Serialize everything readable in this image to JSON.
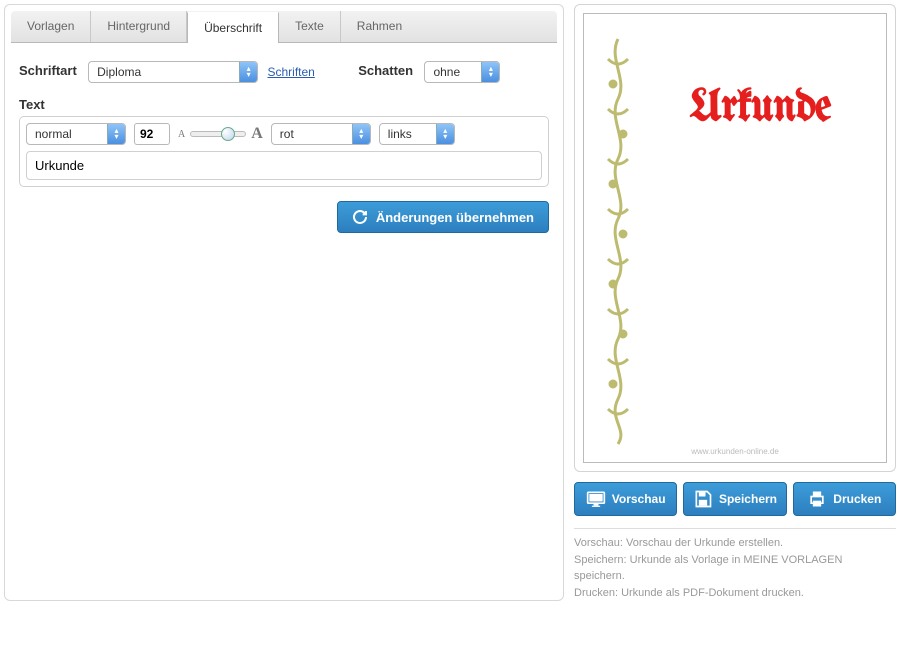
{
  "tabs": [
    {
      "label": "Vorlagen"
    },
    {
      "label": "Hintergrund"
    },
    {
      "label": "Überschrift",
      "active": true
    },
    {
      "label": "Texte"
    },
    {
      "label": "Rahmen"
    }
  ],
  "font_row": {
    "label": "Schriftart",
    "selected_font": "Diploma",
    "fonts_link": "Schriften",
    "shadow_label": "Schatten",
    "shadow_value": "ohne"
  },
  "text_section": {
    "label": "Text",
    "style_value": "normal",
    "size_value": "92",
    "color_value": "rot",
    "align_value": "links",
    "text_value": "Urkunde"
  },
  "apply_button": "Änderungen übernehmen",
  "certificate": {
    "title": "Urkunde",
    "footer": "www.urkunden-online.de"
  },
  "preview_buttons": {
    "preview": "Vorschau",
    "save": "Speichern",
    "print": "Drucken"
  },
  "help": {
    "line1": "Vorschau: Vorschau der Urkunde erstellen.",
    "line2": "Speichern: Urkunde als Vorlage in MEINE VORLAGEN speichern.",
    "line3": "Drucken: Urkunde als PDF-Dokument drucken."
  }
}
